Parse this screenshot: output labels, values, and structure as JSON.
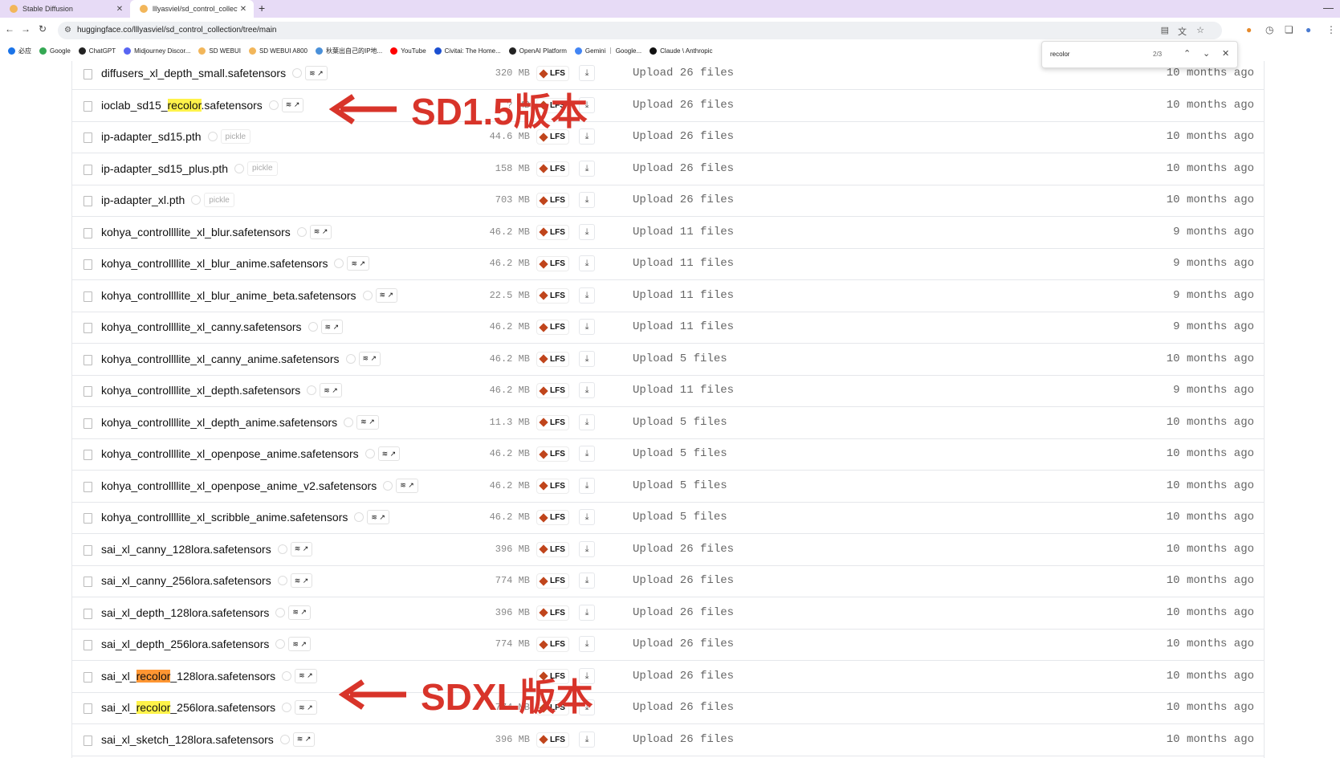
{
  "tabs": [
    {
      "title": "Stable Diffusion",
      "active": false
    },
    {
      "title": "lllyasviel/sd_control_collectio",
      "active": true
    }
  ],
  "address_bar": {
    "url": "huggingface.co/lllyasviel/sd_control_collection/tree/main"
  },
  "bookmarks": [
    {
      "label": "必应",
      "color": "#1a73e8"
    },
    {
      "label": "Google",
      "color": "#34a853"
    },
    {
      "label": "ChatGPT",
      "color": "#222222"
    },
    {
      "label": "Midjourney Discor...",
      "color": "#5865f2"
    },
    {
      "label": "SD WEBUI",
      "color": "#f2b65a"
    },
    {
      "label": "SD WEBUI A800",
      "color": "#f2b65a"
    },
    {
      "label": "秋葉出自己的IP地...",
      "color": "#4a90d9"
    },
    {
      "label": "YouTube",
      "color": "#ff0000"
    },
    {
      "label": "Civitai: The Home...",
      "color": "#1b4fd1"
    },
    {
      "label": "OpenAI Platform",
      "color": "#222222"
    },
    {
      "label": "Gemini ｜ Google...",
      "color": "#4285f4"
    },
    {
      "label": "Claude \\ Anthropic",
      "color": "#111111"
    }
  ],
  "find_bar": {
    "query": "recolor",
    "count": "2/3"
  },
  "files": [
    {
      "pre": "diffusers_xl_depth_small.safetensors",
      "hl": "",
      "post": "",
      "hlstyle": "",
      "badge": "safetensors",
      "size": "320 MB",
      "lfs": "LFS",
      "commit": "Upload 26 files",
      "date": "10 months ago"
    },
    {
      "pre": "ioclab_sd15_",
      "hl": "recolor",
      "post": ".safetensors",
      "hlstyle": "hl",
      "badge": "safetensors",
      "size": "? MB",
      "lfs": "LFS",
      "commit": "Upload 26 files",
      "date": "10 months ago"
    },
    {
      "pre": "ip-adapter_sd15.pth",
      "hl": "",
      "post": "",
      "hlstyle": "",
      "badge": "pickle",
      "size": "44.6 MB",
      "lfs": "LFS",
      "commit": "Upload 26 files",
      "date": "10 months ago"
    },
    {
      "pre": "ip-adapter_sd15_plus.pth",
      "hl": "",
      "post": "",
      "hlstyle": "",
      "badge": "pickle",
      "size": "158 MB",
      "lfs": "LFS",
      "commit": "Upload 26 files",
      "date": "10 months ago"
    },
    {
      "pre": "ip-adapter_xl.pth",
      "hl": "",
      "post": "",
      "hlstyle": "",
      "badge": "pickle",
      "size": "703 MB",
      "lfs": "LFS",
      "commit": "Upload 26 files",
      "date": "10 months ago"
    },
    {
      "pre": "kohya_controllllite_xl_blur.safetensors",
      "hl": "",
      "post": "",
      "hlstyle": "",
      "badge": "safetensors",
      "size": "46.2 MB",
      "lfs": "LFS",
      "commit": "Upload 11 files",
      "date": "9 months ago"
    },
    {
      "pre": "kohya_controllllite_xl_blur_anime.safetensors",
      "hl": "",
      "post": "",
      "hlstyle": "",
      "badge": "safetensors",
      "size": "46.2 MB",
      "lfs": "LFS",
      "commit": "Upload 11 files",
      "date": "9 months ago"
    },
    {
      "pre": "kohya_controllllite_xl_blur_anime_beta.safetensors",
      "hl": "",
      "post": "",
      "hlstyle": "",
      "badge": "safetensors",
      "size": "22.5 MB",
      "lfs": "LFS",
      "commit": "Upload 11 files",
      "date": "9 months ago"
    },
    {
      "pre": "kohya_controllllite_xl_canny.safetensors",
      "hl": "",
      "post": "",
      "hlstyle": "",
      "badge": "safetensors",
      "size": "46.2 MB",
      "lfs": "LFS",
      "commit": "Upload 11 files",
      "date": "9 months ago"
    },
    {
      "pre": "kohya_controllllite_xl_canny_anime.safetensors",
      "hl": "",
      "post": "",
      "hlstyle": "",
      "badge": "safetensors",
      "size": "46.2 MB",
      "lfs": "LFS",
      "commit": "Upload 5 files",
      "date": "10 months ago"
    },
    {
      "pre": "kohya_controllllite_xl_depth.safetensors",
      "hl": "",
      "post": "",
      "hlstyle": "",
      "badge": "safetensors",
      "size": "46.2 MB",
      "lfs": "LFS",
      "commit": "Upload 11 files",
      "date": "9 months ago"
    },
    {
      "pre": "kohya_controllllite_xl_depth_anime.safetensors",
      "hl": "",
      "post": "",
      "hlstyle": "",
      "badge": "safetensors",
      "size": "11.3 MB",
      "lfs": "LFS",
      "commit": "Upload 5 files",
      "date": "10 months ago"
    },
    {
      "pre": "kohya_controllllite_xl_openpose_anime.safetensors",
      "hl": "",
      "post": "",
      "hlstyle": "",
      "badge": "safetensors",
      "size": "46.2 MB",
      "lfs": "LFS",
      "commit": "Upload 5 files",
      "date": "10 months ago"
    },
    {
      "pre": "kohya_controllllite_xl_openpose_anime_v2.safetensors",
      "hl": "",
      "post": "",
      "hlstyle": "",
      "badge": "safetensors",
      "size": "46.2 MB",
      "lfs": "LFS",
      "commit": "Upload 5 files",
      "date": "10 months ago"
    },
    {
      "pre": "kohya_controllllite_xl_scribble_anime.safetensors",
      "hl": "",
      "post": "",
      "hlstyle": "",
      "badge": "safetensors",
      "size": "46.2 MB",
      "lfs": "LFS",
      "commit": "Upload 5 files",
      "date": "10 months ago"
    },
    {
      "pre": "sai_xl_canny_128lora.safetensors",
      "hl": "",
      "post": "",
      "hlstyle": "",
      "badge": "safetensors",
      "size": "396 MB",
      "lfs": "LFS",
      "commit": "Upload 26 files",
      "date": "10 months ago"
    },
    {
      "pre": "sai_xl_canny_256lora.safetensors",
      "hl": "",
      "post": "",
      "hlstyle": "",
      "badge": "safetensors",
      "size": "774 MB",
      "lfs": "LFS",
      "commit": "Upload 26 files",
      "date": "10 months ago"
    },
    {
      "pre": "sai_xl_depth_128lora.safetensors",
      "hl": "",
      "post": "",
      "hlstyle": "",
      "badge": "safetensors",
      "size": "396 MB",
      "lfs": "LFS",
      "commit": "Upload 26 files",
      "date": "10 months ago"
    },
    {
      "pre": "sai_xl_depth_256lora.safetensors",
      "hl": "",
      "post": "",
      "hlstyle": "",
      "badge": "safetensors",
      "size": "774 MB",
      "lfs": "LFS",
      "commit": "Upload 26 files",
      "date": "10 months ago"
    },
    {
      "pre": "sai_xl_",
      "hl": "recolor",
      "post": "_128lora.safetensors",
      "hlstyle": "hl2",
      "badge": "safetensors",
      "size": "",
      "lfs": "LFS",
      "commit": "Upload 26 files",
      "date": "10 months ago"
    },
    {
      "pre": "sai_xl_",
      "hl": "recolor",
      "post": "_256lora.safetensors",
      "hlstyle": "hl",
      "badge": "safetensors",
      "size": "774 MB",
      "lfs": "LFS",
      "commit": "Upload 26 files",
      "date": "10 months ago"
    },
    {
      "pre": "sai_xl_sketch_128lora.safetensors",
      "hl": "",
      "post": "",
      "hlstyle": "",
      "badge": "safetensors",
      "size": "396 MB",
      "lfs": "LFS",
      "commit": "Upload 26 files",
      "date": "10 months ago"
    }
  ],
  "annotations": [
    {
      "text": "SD1.5版本",
      "color": "#d8342a"
    },
    {
      "text": "SDXL版本",
      "color": "#d8342a"
    }
  ]
}
